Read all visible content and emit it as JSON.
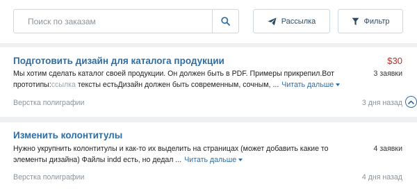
{
  "search": {
    "placeholder": "Поиск по заказам",
    "value": ""
  },
  "toolbar": {
    "mailing_label": "Рассылка",
    "filter_label": "Фильтр"
  },
  "orders": [
    {
      "title": "Подготовить дизайн для каталога продукции",
      "price": "$30",
      "bids": "3 заявки",
      "desc_line1": "Мы хотим сделать каталог своей продукции. Он должен быть в PDF. Примеры прикрепил.Вот",
      "desc_line2_a": "прототипы:",
      "desc_line2_link": "ссылка",
      "desc_line2_b": " тексты естьДизайн должен быть современным, сочным, ...",
      "read_more": "Читать дальше",
      "category": "Верстка полиграфии",
      "time": "3 дня назад"
    },
    {
      "title": "Изменить колонтитулы",
      "price": "",
      "bids": "4 заявки",
      "desc_line1": "Нужно укрупнить колонтитулы и как-то их выделить на страницах (может добавить какие то",
      "desc_line2_a": "элементы дизайна) Файлы indd есть, но дедал ...",
      "read_more": "Читать дальше",
      "category": "Верстка полиграфии",
      "time": "4 дня назад"
    }
  ],
  "icons": {
    "search": "search-icon",
    "mailing": "paper-plane-icon",
    "filter": "funnel-icon",
    "scroll_up": "chevron-up-icon"
  },
  "colors": {
    "accent": "#2e6da4",
    "price": "#c62828",
    "muted": "#8a949c",
    "border": "#c9d8e3",
    "background": "#eef0f2"
  }
}
